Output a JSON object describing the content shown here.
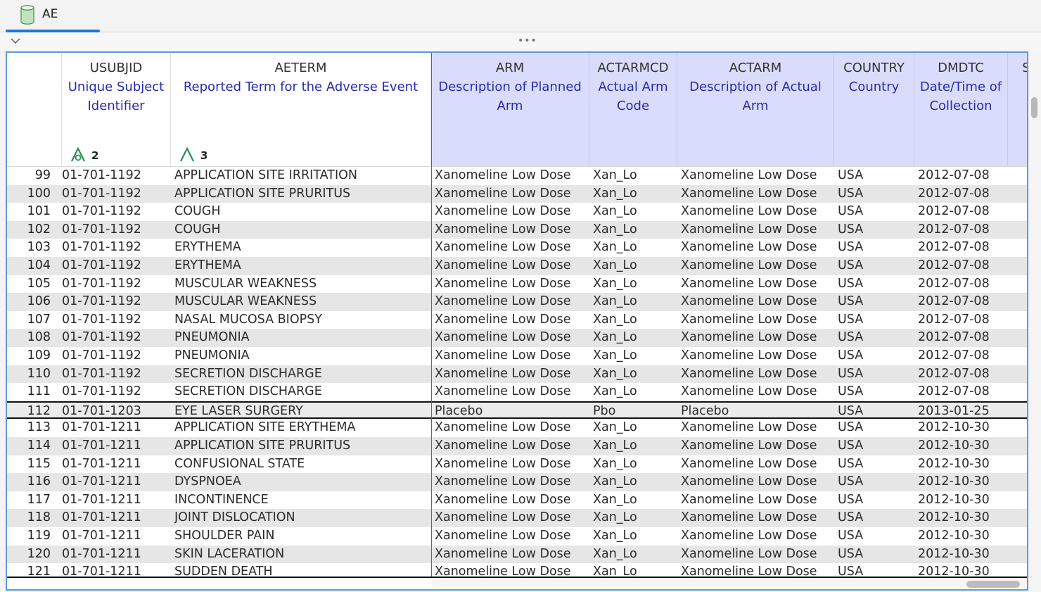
{
  "tab": {
    "label": "AE"
  },
  "columns": [
    {
      "code": "USUBJID",
      "desc": "Unique Subject Identifier",
      "sort": "2"
    },
    {
      "code": "AETERM",
      "desc": "Reported Term for the Adverse Event",
      "sort": "3"
    },
    {
      "code": "ARM",
      "desc": "Description of Planned Arm"
    },
    {
      "code": "ACTARMCD",
      "desc": "Actual Arm Code"
    },
    {
      "code": "ACTARM",
      "desc": "Description of Actual Arm"
    },
    {
      "code": "COUNTRY",
      "desc": "Country"
    },
    {
      "code": "DMDTC",
      "desc": "Date/Time of Collection"
    },
    {
      "code": "St",
      "desc": "("
    }
  ],
  "rows": [
    {
      "n": "99",
      "usubjid": "01-701-1192",
      "aeterm": "APPLICATION SITE IRRITATION",
      "arm": "Xanomeline Low Dose",
      "actarmcd": "Xan_Lo",
      "actarm": "Xanomeline Low Dose",
      "country": "USA",
      "dmdtc": "2012-07-08"
    },
    {
      "n": "100",
      "usubjid": "01-701-1192",
      "aeterm": "APPLICATION SITE PRURITUS",
      "arm": "Xanomeline Low Dose",
      "actarmcd": "Xan_Lo",
      "actarm": "Xanomeline Low Dose",
      "country": "USA",
      "dmdtc": "2012-07-08"
    },
    {
      "n": "101",
      "usubjid": "01-701-1192",
      "aeterm": "COUGH",
      "arm": "Xanomeline Low Dose",
      "actarmcd": "Xan_Lo",
      "actarm": "Xanomeline Low Dose",
      "country": "USA",
      "dmdtc": "2012-07-08"
    },
    {
      "n": "102",
      "usubjid": "01-701-1192",
      "aeterm": "COUGH",
      "arm": "Xanomeline Low Dose",
      "actarmcd": "Xan_Lo",
      "actarm": "Xanomeline Low Dose",
      "country": "USA",
      "dmdtc": "2012-07-08"
    },
    {
      "n": "103",
      "usubjid": "01-701-1192",
      "aeterm": "ERYTHEMA",
      "arm": "Xanomeline Low Dose",
      "actarmcd": "Xan_Lo",
      "actarm": "Xanomeline Low Dose",
      "country": "USA",
      "dmdtc": "2012-07-08"
    },
    {
      "n": "104",
      "usubjid": "01-701-1192",
      "aeterm": "ERYTHEMA",
      "arm": "Xanomeline Low Dose",
      "actarmcd": "Xan_Lo",
      "actarm": "Xanomeline Low Dose",
      "country": "USA",
      "dmdtc": "2012-07-08"
    },
    {
      "n": "105",
      "usubjid": "01-701-1192",
      "aeterm": "MUSCULAR WEAKNESS",
      "arm": "Xanomeline Low Dose",
      "actarmcd": "Xan_Lo",
      "actarm": "Xanomeline Low Dose",
      "country": "USA",
      "dmdtc": "2012-07-08"
    },
    {
      "n": "106",
      "usubjid": "01-701-1192",
      "aeterm": "MUSCULAR WEAKNESS",
      "arm": "Xanomeline Low Dose",
      "actarmcd": "Xan_Lo",
      "actarm": "Xanomeline Low Dose",
      "country": "USA",
      "dmdtc": "2012-07-08"
    },
    {
      "n": "107",
      "usubjid": "01-701-1192",
      "aeterm": "NASAL MUCOSA BIOPSY",
      "arm": "Xanomeline Low Dose",
      "actarmcd": "Xan_Lo",
      "actarm": "Xanomeline Low Dose",
      "country": "USA",
      "dmdtc": "2012-07-08"
    },
    {
      "n": "108",
      "usubjid": "01-701-1192",
      "aeterm": "PNEUMONIA",
      "arm": "Xanomeline Low Dose",
      "actarmcd": "Xan_Lo",
      "actarm": "Xanomeline Low Dose",
      "country": "USA",
      "dmdtc": "2012-07-08"
    },
    {
      "n": "109",
      "usubjid": "01-701-1192",
      "aeterm": "PNEUMONIA",
      "arm": "Xanomeline Low Dose",
      "actarmcd": "Xan_Lo",
      "actarm": "Xanomeline Low Dose",
      "country": "USA",
      "dmdtc": "2012-07-08"
    },
    {
      "n": "110",
      "usubjid": "01-701-1192",
      "aeterm": "SECRETION DISCHARGE",
      "arm": "Xanomeline Low Dose",
      "actarmcd": "Xan_Lo",
      "actarm": "Xanomeline Low Dose",
      "country": "USA",
      "dmdtc": "2012-07-08"
    },
    {
      "n": "111",
      "usubjid": "01-701-1192",
      "aeterm": "SECRETION DISCHARGE",
      "arm": "Xanomeline Low Dose",
      "actarmcd": "Xan_Lo",
      "actarm": "Xanomeline Low Dose",
      "country": "USA",
      "dmdtc": "2012-07-08"
    },
    {
      "n": "112",
      "usubjid": "01-701-1203",
      "aeterm": "EYE LASER SURGERY",
      "arm": "Placebo",
      "actarmcd": "Pbo",
      "actarm": "Placebo",
      "country": "USA",
      "dmdtc": "2013-01-25"
    },
    {
      "n": "113",
      "usubjid": "01-701-1211",
      "aeterm": "APPLICATION SITE ERYTHEMA",
      "arm": "Xanomeline Low Dose",
      "actarmcd": "Xan_Lo",
      "actarm": "Xanomeline Low Dose",
      "country": "USA",
      "dmdtc": "2012-10-30"
    },
    {
      "n": "114",
      "usubjid": "01-701-1211",
      "aeterm": "APPLICATION SITE PRURITUS",
      "arm": "Xanomeline Low Dose",
      "actarmcd": "Xan_Lo",
      "actarm": "Xanomeline Low Dose",
      "country": "USA",
      "dmdtc": "2012-10-30"
    },
    {
      "n": "115",
      "usubjid": "01-701-1211",
      "aeterm": "CONFUSIONAL STATE",
      "arm": "Xanomeline Low Dose",
      "actarmcd": "Xan_Lo",
      "actarm": "Xanomeline Low Dose",
      "country": "USA",
      "dmdtc": "2012-10-30"
    },
    {
      "n": "116",
      "usubjid": "01-701-1211",
      "aeterm": "DYSPNOEA",
      "arm": "Xanomeline Low Dose",
      "actarmcd": "Xan_Lo",
      "actarm": "Xanomeline Low Dose",
      "country": "USA",
      "dmdtc": "2012-10-30"
    },
    {
      "n": "117",
      "usubjid": "01-701-1211",
      "aeterm": "INCONTINENCE",
      "arm": "Xanomeline Low Dose",
      "actarmcd": "Xan_Lo",
      "actarm": "Xanomeline Low Dose",
      "country": "USA",
      "dmdtc": "2012-10-30"
    },
    {
      "n": "118",
      "usubjid": "01-701-1211",
      "aeterm": "JOINT DISLOCATION",
      "arm": "Xanomeline Low Dose",
      "actarmcd": "Xan_Lo",
      "actarm": "Xanomeline Low Dose",
      "country": "USA",
      "dmdtc": "2012-10-30"
    },
    {
      "n": "119",
      "usubjid": "01-701-1211",
      "aeterm": "SHOULDER PAIN",
      "arm": "Xanomeline Low Dose",
      "actarmcd": "Xan_Lo",
      "actarm": "Xanomeline Low Dose",
      "country": "USA",
      "dmdtc": "2012-10-30"
    },
    {
      "n": "120",
      "usubjid": "01-701-1211",
      "aeterm": "SKIN LACERATION",
      "arm": "Xanomeline Low Dose",
      "actarmcd": "Xan_Lo",
      "actarm": "Xanomeline Low Dose",
      "country": "USA",
      "dmdtc": "2012-10-30"
    },
    {
      "n": "121",
      "usubjid": "01-701-1211",
      "aeterm": "SUDDEN DEATH",
      "arm": "Xanomeline Low Dose",
      "actarmcd": "Xan_Lo",
      "actarm": "Xanomeline Low Dose",
      "country": "USA",
      "dmdtc": "2012-10-30"
    }
  ],
  "highlighted_row": "112",
  "icons": {
    "tab": "database-icon",
    "collapse": "chevron-down-icon",
    "more": "more-dots-icon",
    "sort": "sort-icon"
  },
  "colors": {
    "accent": "#1f78d1",
    "selected_header": "#d9dcfb",
    "label_blue": "#2a2ab0",
    "alt_row": "#e6e6e6"
  }
}
